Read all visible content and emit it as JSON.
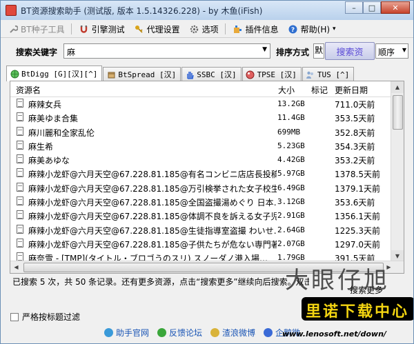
{
  "window": {
    "title": "BT资源搜索助手 (测试版, 版本 1.5.14326.228) - by 木鱼(iFish)",
    "minimize": "–",
    "maximize": "□",
    "close": "✕"
  },
  "menu": {
    "items": [
      {
        "label": "BT种子工具",
        "icon": "wrench-icon",
        "disabled": true
      },
      {
        "label": "引擎测试",
        "icon": "magnet-icon"
      },
      {
        "label": "代理设置",
        "icon": "key-icon"
      },
      {
        "label": "选项",
        "icon": "gear-icon"
      },
      {
        "label": "插件信息",
        "icon": "plugin-icon"
      },
      {
        "label": "帮助(H)",
        "icon": "help-icon",
        "suffix": "▾"
      }
    ]
  },
  "search": {
    "keyword_label": "搜索关键字",
    "keyword_value": "麻",
    "sort_label": "排序方式",
    "sort_value": "默",
    "search_button": "搜索资",
    "order_value": "顺序"
  },
  "tabs": [
    {
      "label": "BtDigg [G][汉][^]",
      "icon": "globe-icon",
      "color": "#3aa63a",
      "active": true
    },
    {
      "label": "BtSpread [汉]",
      "icon": "box-icon",
      "color": "#8a6a3a"
    },
    {
      "label": "SSBC [汉]",
      "icon": "hand-icon",
      "color": "#3a6ad6"
    },
    {
      "label": "TPSE [汉]",
      "icon": "ball-icon",
      "color": "#c04040"
    },
    {
      "label": "TUS [^]",
      "icon": "users-icon",
      "color": "#6a8ab0"
    }
  ],
  "table": {
    "columns": {
      "name": "资源名",
      "size": "大小",
      "mark": "标记",
      "date": "更新日期"
    },
    "rows": [
      {
        "name": "麻辣女兵",
        "size": "13.2GB",
        "date": "711.0天前"
      },
      {
        "name": "麻美ゆま合集",
        "size": "11.4GB",
        "date": "353.5天前"
      },
      {
        "name": "麻川麗和全家乱伦",
        "size": "699MB",
        "date": "352.8天前"
      },
      {
        "name": "麻生希",
        "size": "5.23GB",
        "date": "354.3天前"
      },
      {
        "name": "麻美あゆな",
        "size": "4.42GB",
        "date": "353.2天前"
      },
      {
        "name": "麻辣小龙虾@六月天空@67.228.81.185@有名コンビニ店店長投稿…",
        "size": "5.97GB",
        "date": "1378.5天前"
      },
      {
        "name": "麻辣小龙虾@六月天空@67.228.81.185@万引検挙された女子校生",
        "size": "6.49GB",
        "date": "1379.1天前"
      },
      {
        "name": "麻辣小龙虾@六月天空@67.228.81.185@全国盗撮湯めぐり 日本…",
        "size": "3.12GB",
        "date": "353.6天前"
      },
      {
        "name": "麻辣小龙虾@六月天空@67.228.81.185@体調不良を訴える女子児…",
        "size": "2.91GB",
        "date": "1356.1天前"
      },
      {
        "name": "麻辣小龙虾@六月天空@67.228.81.185@生徒指導室盗撮 わいせ…",
        "size": "2.64GB",
        "date": "1225.3天前"
      },
      {
        "name": "麻辣小龙虾@六月天空@67.228.81.185@子供たちが危ない専門著…",
        "size": "2.07GB",
        "date": "1297.0天前"
      },
      {
        "name": "麻奈雪 - [TMP](タイトル・ブロゴうのスリ) スノーダノ港入場…",
        "size": "1.79GB",
        "date": "391.5天前"
      }
    ]
  },
  "status": {
    "text": "已搜索 5 次，共 50 条记录。还有更多资源，点击“搜索更多”继续向后搜索。双击",
    "more_button": "搜索更多"
  },
  "filter": {
    "label": "严格按标题过滤"
  },
  "links": [
    {
      "label": "助手官网",
      "color": "#3a9ad9"
    },
    {
      "label": "反馈论坛",
      "color": "#3aa63a"
    },
    {
      "label": "渣浪微博",
      "color": "#d9b33a"
    },
    {
      "label": "企鹅微",
      "color": "#3a6ad6"
    }
  ],
  "watermark": {
    "big": "大眼仔旭",
    "logo": "里诺下载中心",
    "url": "www.lenosoft.net/down/"
  },
  "colors": {
    "accent": "#5b4bd6",
    "link": "#1a55b5"
  }
}
